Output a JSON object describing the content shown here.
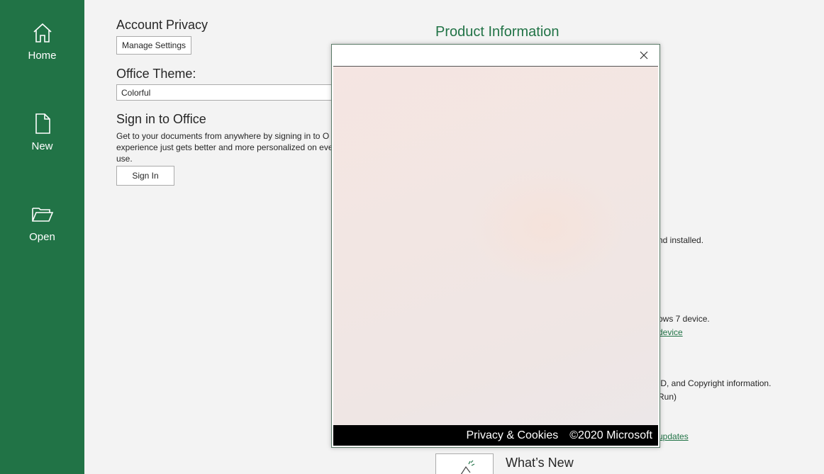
{
  "nav": {
    "items": [
      {
        "label": "Home",
        "icon": "home-icon"
      },
      {
        "label": "New",
        "icon": "new-document-icon"
      },
      {
        "label": "Open",
        "icon": "folder-open-icon"
      }
    ]
  },
  "account_privacy": {
    "heading": "Account Privacy",
    "button": "Manage Settings"
  },
  "office_theme": {
    "heading": "Office Theme:",
    "selected": "Colorful"
  },
  "sign_in": {
    "heading": "Sign in to Office",
    "line1": "Get to your documents from anywhere by signing in to O",
    "line2": "experience just gets better and more personalized on eve",
    "line3": "use.",
    "button": "Sign In"
  },
  "product_info": {
    "title": "Product Information",
    "text1": "nd installed.",
    "text2": "ows 7 device.",
    "link1": "device",
    "text3": "ID, and Copyright information.",
    "text4": "Run)",
    "link2": "updates",
    "whats_new": "What’s New"
  },
  "modal": {
    "footer_privacy": "Privacy & Cookies",
    "footer_copyright": "©2020 Microsoft"
  },
  "colors": {
    "accent": "#217346",
    "background": "#f3f3f3"
  }
}
